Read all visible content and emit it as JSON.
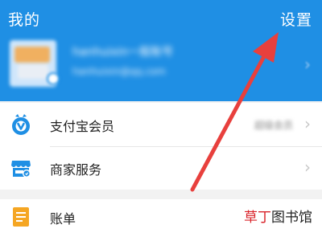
{
  "header": {
    "title": "我的",
    "settings_label": "设置"
  },
  "profile": {
    "name": "hanhuixin一般账号",
    "account": "hanhuixin@qq.com"
  },
  "menu": {
    "items": [
      {
        "label": "支付宝会员",
        "value": "超级会员",
        "icon": "member-badge-icon"
      },
      {
        "label": "商家服务",
        "value": "",
        "icon": "store-icon"
      }
    ]
  },
  "menu2": {
    "items": [
      {
        "label": "账单",
        "icon": "bill-icon"
      }
    ]
  },
  "watermark": {
    "part1": "草丁",
    "part2": "图书馆"
  },
  "colors": {
    "header_bg": "#1f8fe4",
    "annotation_arrow": "#e8403d",
    "member_icon": "#1f8fe4",
    "bill_icon": "#f5a623"
  }
}
